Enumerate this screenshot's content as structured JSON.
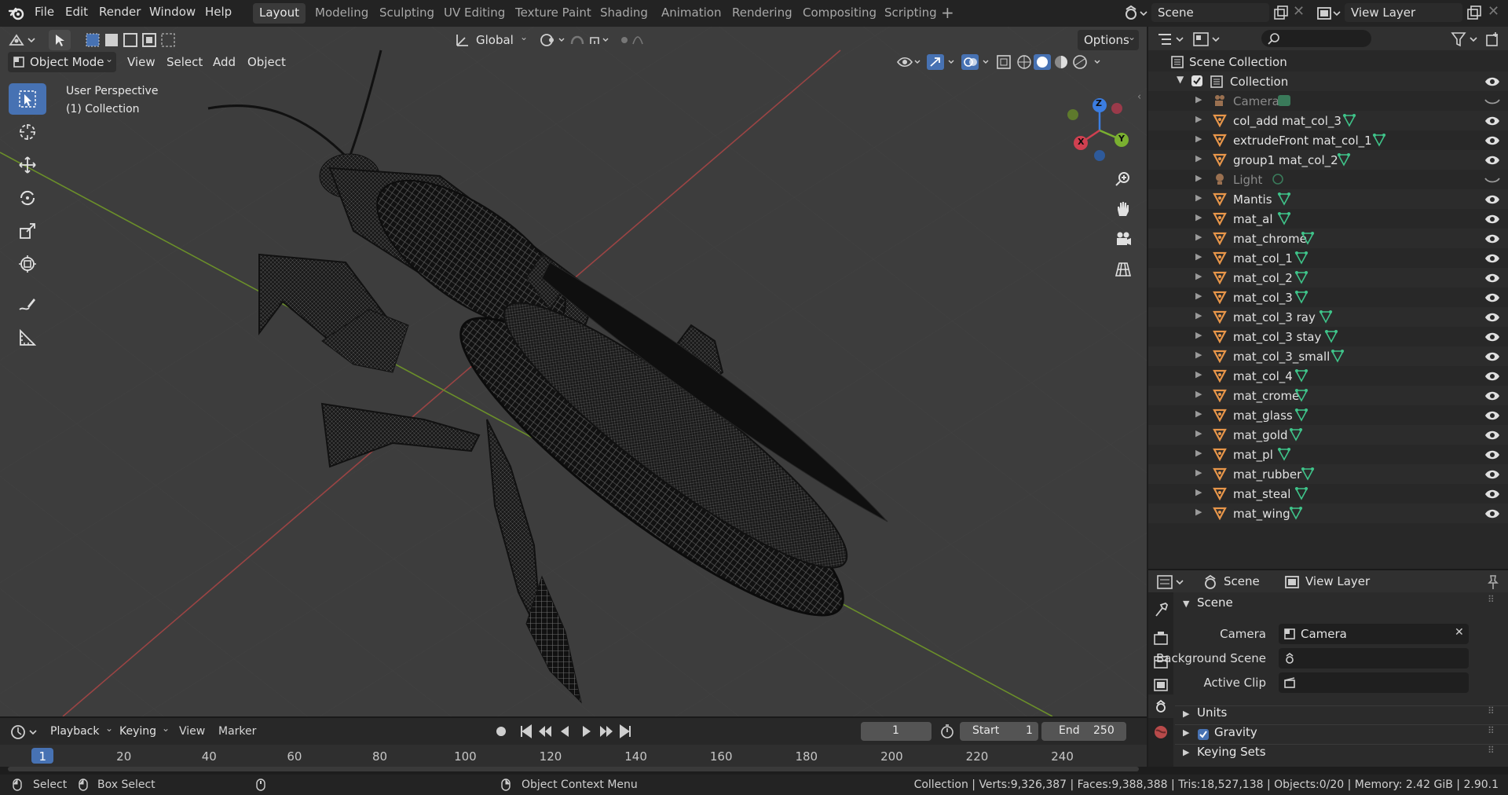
{
  "menu": {
    "file": "File",
    "edit": "Edit",
    "render": "Render",
    "window": "Window",
    "help": "Help"
  },
  "workspaces": [
    "Layout",
    "Modeling",
    "Sculpting",
    "UV Editing",
    "Texture Paint",
    "Shading",
    "Animation",
    "Rendering",
    "Compositing",
    "Scripting"
  ],
  "scene_field": "Scene",
  "view_layer_field": "View Layer",
  "header": {
    "transform_orientation": "Global",
    "options": "Options",
    "mode": "Object Mode",
    "view": "View",
    "select": "Select",
    "add": "Add",
    "object": "Object"
  },
  "viewport": {
    "perspective": "User Perspective",
    "collection": "(1) Collection",
    "gizmo": {
      "x": "X",
      "y": "Y",
      "z": "Z"
    }
  },
  "outliner": {
    "root": "Scene Collection",
    "collection": "Collection",
    "items": [
      {
        "name": "Camera",
        "type": "camera",
        "hidden": true
      },
      {
        "name": "col_add mat_col_3",
        "type": "mesh"
      },
      {
        "name": "extrudeFront mat_col_1",
        "type": "mesh"
      },
      {
        "name": "group1 mat_col_2",
        "type": "mesh"
      },
      {
        "name": "Light",
        "type": "light",
        "hidden": true
      },
      {
        "name": "Mantis",
        "type": "mesh"
      },
      {
        "name": "mat_al",
        "type": "mesh"
      },
      {
        "name": "mat_chrome",
        "type": "mesh"
      },
      {
        "name": "mat_col_1",
        "type": "mesh"
      },
      {
        "name": "mat_col_2",
        "type": "mesh"
      },
      {
        "name": "mat_col_3",
        "type": "mesh"
      },
      {
        "name": "mat_col_3 ray",
        "type": "mesh"
      },
      {
        "name": "mat_col_3 stay",
        "type": "mesh"
      },
      {
        "name": "mat_col_3_small",
        "type": "mesh"
      },
      {
        "name": "mat_col_4",
        "type": "mesh"
      },
      {
        "name": "mat_crome",
        "type": "mesh"
      },
      {
        "name": "mat_glass",
        "type": "mesh"
      },
      {
        "name": "mat_gold",
        "type": "mesh"
      },
      {
        "name": "mat_pl",
        "type": "mesh"
      },
      {
        "name": "mat_rubber",
        "type": "mesh"
      },
      {
        "name": "mat_steal",
        "type": "mesh"
      },
      {
        "name": "mat_wing",
        "type": "mesh"
      }
    ]
  },
  "properties": {
    "tab_scene": "Scene",
    "tab_view_layer": "View Layer",
    "panel_scene": "Scene",
    "camera_label": "Camera",
    "camera_value": "Camera",
    "background_scene_label": "Background Scene",
    "active_clip_label": "Active Clip",
    "units": "Units",
    "gravity": "Gravity",
    "keying_sets": "Keying Sets"
  },
  "timeline": {
    "playback": "Playback",
    "keying": "Keying",
    "view": "View",
    "marker": "Marker",
    "current_frame": "1",
    "start_label": "Start",
    "start_value": "1",
    "end_label": "End",
    "end_value": "250",
    "ruler": [
      "1",
      "20",
      "40",
      "60",
      "80",
      "100",
      "120",
      "140",
      "160",
      "180",
      "200",
      "220",
      "240"
    ]
  },
  "status": {
    "select": "Select",
    "box_select": "Box Select",
    "context_menu": "Object Context Menu",
    "stats": "Collection | Verts:9,326,387 | Faces:9,388,388 | Tris:18,527,138 | Objects:0/20 | Memory: 2.42 GiB | 2.90.1"
  },
  "colors": {
    "accent": "#4772b3",
    "mesh_icon": "#e8964a",
    "data_icon": "#3fc48a",
    "x_axis": "#b84a4a",
    "y_axis": "#6b8f2a"
  }
}
